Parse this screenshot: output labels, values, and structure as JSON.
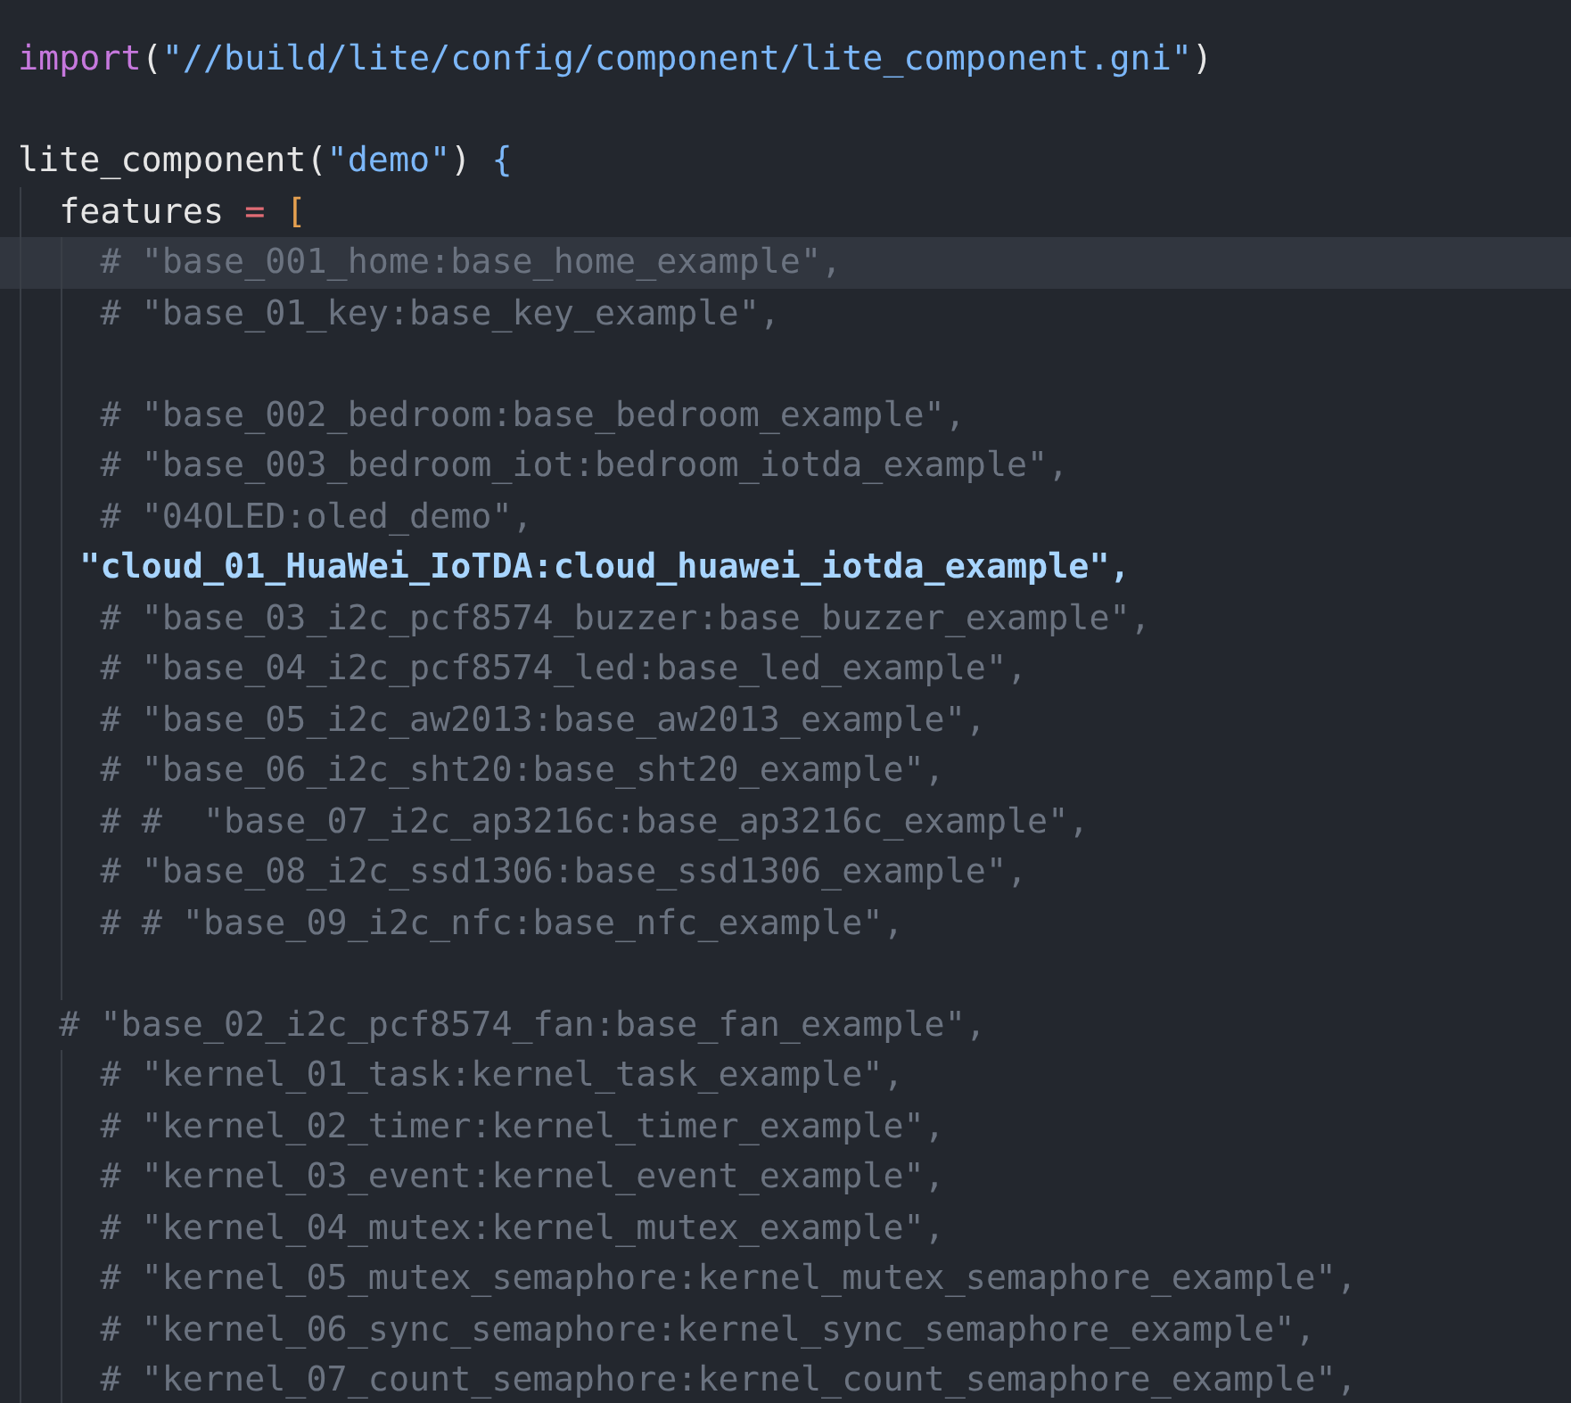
{
  "editor": {
    "lines": [
      {
        "kind": "code",
        "current": false,
        "tokens": [
          {
            "kind": "function",
            "text": "import"
          },
          {
            "kind": "punct",
            "text": "("
          },
          {
            "kind": "string",
            "text": "\"//build/lite/config/component/lite_component.gni\""
          },
          {
            "kind": "punct",
            "text": ")"
          }
        ]
      },
      {
        "kind": "blank"
      },
      {
        "kind": "code",
        "current": false,
        "tokens": [
          {
            "kind": "plain",
            "text": "lite_component"
          },
          {
            "kind": "punct",
            "text": "("
          },
          {
            "kind": "string",
            "text": "\"demo\""
          },
          {
            "kind": "punct",
            "text": ") "
          },
          {
            "kind": "brace",
            "text": "{"
          }
        ]
      },
      {
        "kind": "code",
        "current": false,
        "tokens": [
          {
            "kind": "plain",
            "text": "  features "
          },
          {
            "kind": "operator",
            "text": "= "
          },
          {
            "kind": "bracket",
            "text": "["
          }
        ]
      },
      {
        "kind": "code",
        "current": true,
        "tokens": [
          {
            "kind": "comment",
            "text": "    # \"base_001_home:base_home_example\","
          }
        ]
      },
      {
        "kind": "code",
        "current": false,
        "tokens": [
          {
            "kind": "comment",
            "text": "    # \"base_01_key:base_key_example\","
          }
        ]
      },
      {
        "kind": "blank"
      },
      {
        "kind": "code",
        "current": false,
        "tokens": [
          {
            "kind": "comment",
            "text": "    # \"base_002_bedroom:base_bedroom_example\","
          }
        ]
      },
      {
        "kind": "code",
        "current": false,
        "tokens": [
          {
            "kind": "comment",
            "text": "    # \"base_003_bedroom_iot:bedroom_iotda_example\","
          }
        ]
      },
      {
        "kind": "code",
        "current": false,
        "tokens": [
          {
            "kind": "comment",
            "text": "    # \"04OLED:oled_demo\","
          }
        ]
      },
      {
        "kind": "code",
        "current": false,
        "tokens": [
          {
            "kind": "active_string",
            "text": "   \"cloud_01_HuaWei_IoTDA:cloud_huawei_iotda_example\","
          }
        ]
      },
      {
        "kind": "code",
        "current": false,
        "tokens": [
          {
            "kind": "comment",
            "text": "    # \"base_03_i2c_pcf8574_buzzer:base_buzzer_example\","
          }
        ]
      },
      {
        "kind": "code",
        "current": false,
        "tokens": [
          {
            "kind": "comment",
            "text": "    # \"base_04_i2c_pcf8574_led:base_led_example\","
          }
        ]
      },
      {
        "kind": "code",
        "current": false,
        "tokens": [
          {
            "kind": "comment",
            "text": "    # \"base_05_i2c_aw2013:base_aw2013_example\","
          }
        ]
      },
      {
        "kind": "code",
        "current": false,
        "tokens": [
          {
            "kind": "comment",
            "text": "    # \"base_06_i2c_sht20:base_sht20_example\","
          }
        ]
      },
      {
        "kind": "code",
        "current": false,
        "tokens": [
          {
            "kind": "comment",
            "text": "    # #  \"base_07_i2c_ap3216c:base_ap3216c_example\","
          }
        ]
      },
      {
        "kind": "code",
        "current": false,
        "tokens": [
          {
            "kind": "comment",
            "text": "    # \"base_08_i2c_ssd1306:base_ssd1306_example\","
          }
        ]
      },
      {
        "kind": "code",
        "current": false,
        "tokens": [
          {
            "kind": "comment",
            "text": "    # # \"base_09_i2c_nfc:base_nfc_example\","
          }
        ]
      },
      {
        "kind": "blank"
      },
      {
        "kind": "code",
        "current": false,
        "tokens": [
          {
            "kind": "comment",
            "text": "  # \"base_02_i2c_pcf8574_fan:base_fan_example\","
          }
        ]
      },
      {
        "kind": "code",
        "current": false,
        "tokens": [
          {
            "kind": "comment",
            "text": "    # \"kernel_01_task:kernel_task_example\","
          }
        ]
      },
      {
        "kind": "code",
        "current": false,
        "tokens": [
          {
            "kind": "comment",
            "text": "    # \"kernel_02_timer:kernel_timer_example\","
          }
        ]
      },
      {
        "kind": "code",
        "current": false,
        "tokens": [
          {
            "kind": "comment",
            "text": "    # \"kernel_03_event:kernel_event_example\","
          }
        ]
      },
      {
        "kind": "code",
        "current": false,
        "tokens": [
          {
            "kind": "comment",
            "text": "    # \"kernel_04_mutex:kernel_mutex_example\","
          }
        ]
      },
      {
        "kind": "code",
        "current": false,
        "tokens": [
          {
            "kind": "comment",
            "text": "    # \"kernel_05_mutex_semaphore:kernel_mutex_semaphore_example\","
          }
        ]
      },
      {
        "kind": "code",
        "current": false,
        "tokens": [
          {
            "kind": "comment",
            "text": "    # \"kernel_06_sync_semaphore:kernel_sync_semaphore_example\","
          }
        ]
      },
      {
        "kind": "code",
        "current": false,
        "tokens": [
          {
            "kind": "comment",
            "text": "    # \"kernel_07_count_semaphore:kernel_count_semaphore_example\","
          }
        ]
      }
    ]
  }
}
